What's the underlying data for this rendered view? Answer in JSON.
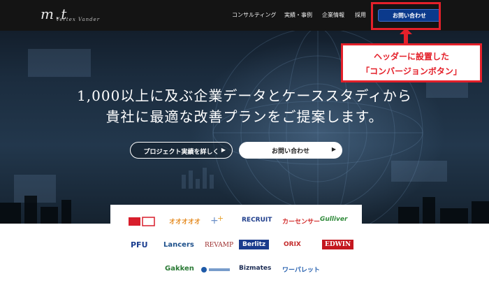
{
  "header": {
    "logo_text": "m.t",
    "logo_sub": "Vertex Vander",
    "nav": [
      {
        "label": "コンサルティング"
      },
      {
        "label": "実績・事例"
      },
      {
        "label": "企業情報"
      },
      {
        "label": "採用"
      }
    ],
    "cta_label": "お問い合わせ"
  },
  "annotation": {
    "line1": "ヘッダーに設置した",
    "line2": "「コンバージョンボタン」",
    "color": "#e4202a"
  },
  "hero": {
    "headline_line1": "1,000以上に及ぶ企業データとケーススタディから",
    "headline_line2": "貴社に最適な改善プランをご提案します。",
    "button_secondary": "プロジェクト実績を詳しく",
    "button_primary": "お問い合わせ"
  },
  "client_logos": [
    {
      "name": "",
      "color": "#d81e2c"
    },
    {
      "name": "オオオオオ",
      "color": "#e58a1f"
    },
    {
      "name": "",
      "color": "#6b8fc8"
    },
    {
      "name": "RECRUIT",
      "color": "#1f3e8c"
    },
    {
      "name": "カーセンサー",
      "color": "#d3302f"
    },
    {
      "name": "Gulliver",
      "color": "#2f8a3a"
    },
    {
      "name": "PFU",
      "color": "#1b3e8f"
    },
    {
      "name": "Lancers",
      "color": "#1c4f8a"
    },
    {
      "name": "REVAMP",
      "color": "#9b2b2b"
    },
    {
      "name": "Berlitz",
      "color": "#1a3b8c"
    },
    {
      "name": "ORIX",
      "color": "#c42a2a"
    },
    {
      "name": "EDWIN",
      "color": "#c4171f"
    },
    {
      "name": "Gakken",
      "color": "#2a7a35"
    },
    {
      "name": "",
      "color": "#1e5aa8"
    },
    {
      "name": "Bizmates",
      "color": "#1d2d55"
    },
    {
      "name": "ワーパレット",
      "color": "#2a63b0"
    }
  ]
}
